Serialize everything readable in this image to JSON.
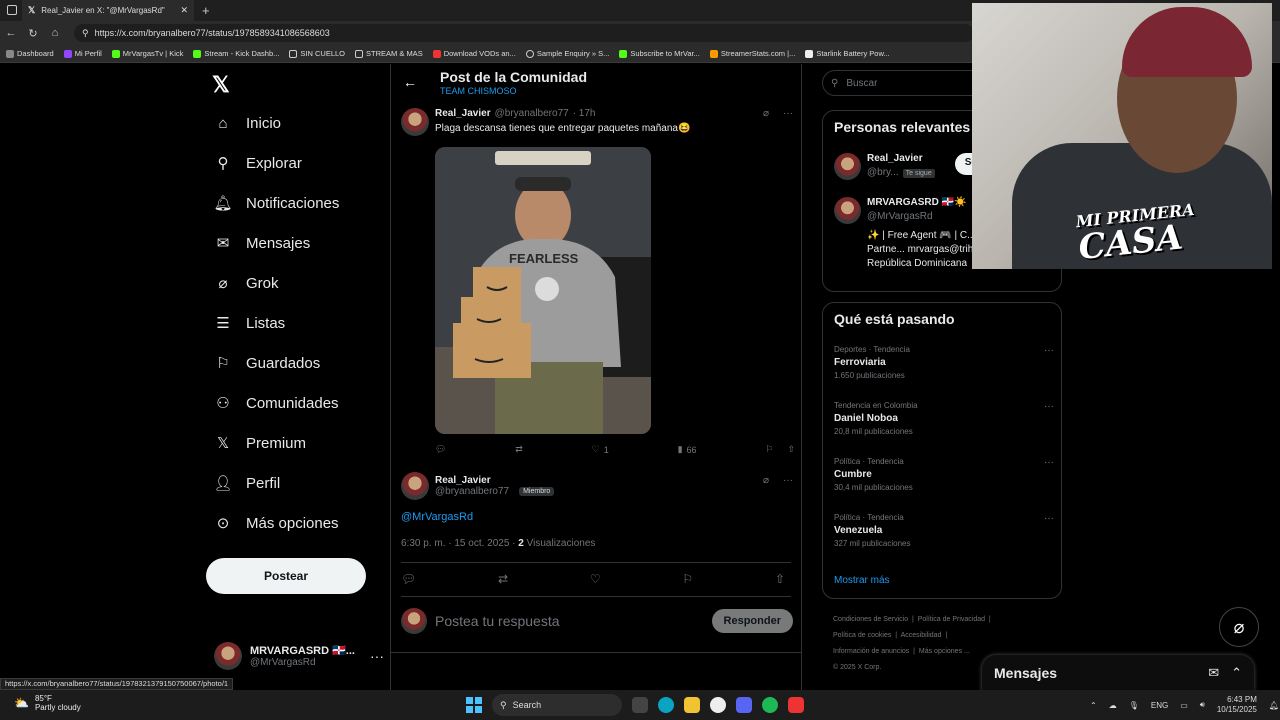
{
  "browser": {
    "tab_title": "Real_Javier en X: \"@MrVargasRd\"",
    "url": "https://x.com/bryanalbero77/status/1978589341086568603",
    "bookmarks": [
      "Dashboard",
      "Mi Perfil",
      "MrVargasTv | Kick",
      "Stream - Kick Dashb...",
      "SIN CUELLO",
      "STREAM & MAS",
      "Download VODs an...",
      "Sample Enquiry » S...",
      "Subscribe to MrVar...",
      "StreamerStats.com |...",
      "Starlink Battery Pow..."
    ],
    "status_url": "https://x.com/bryanalbero77/status/1978321379150750067/photo/1"
  },
  "nav": {
    "items": [
      "Inicio",
      "Explorar",
      "Notificaciones",
      "Mensajes",
      "Grok",
      "Listas",
      "Guardados",
      "Comunidades",
      "Premium",
      "Perfil",
      "Más opciones"
    ],
    "post_button": "Postear",
    "account_name": "MRVARGASRD 🇩🇴...",
    "account_handle": "@MrVargasRd"
  },
  "header": {
    "title": "Post de la Comunidad",
    "subtitle": "TEAM CHISMOSO"
  },
  "post": {
    "name": "Real_Javier",
    "handle": "@bryanalbero77",
    "time": "· 17h",
    "text": "Plaga descansa tienes que entregar paquetes mañana😆",
    "likes": "1",
    "views": "66",
    "image_text": "FEARLESS"
  },
  "reply": {
    "name": "Real_Javier",
    "handle": "@bryanalbero77",
    "badge": "Miembro",
    "mention": "@MrVargasRd",
    "timestamp": "6:30 p. m. · 15 oct. 2025 ·",
    "views_count": "2",
    "views_label": "Visualizaciones",
    "compose_placeholder": "Postea tu respuesta",
    "reply_button": "Responder"
  },
  "sidebar": {
    "search_placeholder": "Buscar",
    "relevant_title": "Personas relevantes",
    "person1_name": "Real_Javier",
    "person1_handle": "@bry...",
    "person1_badge": "Te sigue",
    "person1_btn": "Se",
    "person2_name": "MRVARGASRD 🇩🇴☀️",
    "person2_handle": "@MrVargasRd",
    "person2_bio": "✨ | Free Agent 🎮 | C... Contenido 💚 | Partne... mrvargas@trihaus.es 📍 | República Dominicana",
    "trending_title": "Qué está pasando",
    "trends": [
      {
        "category": "Deportes · Tendencia",
        "name": "Ferroviaria",
        "count": "1.650 publicaciones"
      },
      {
        "category": "Tendencia en Colombia",
        "name": "Daniel Noboa",
        "count": "20,8 mil publicaciones"
      },
      {
        "category": "Política · Tendencia",
        "name": "Cumbre",
        "count": "30,4 mil publicaciones"
      },
      {
        "category": "Política · Tendencia",
        "name": "Venezuela",
        "count": "327 mil publicaciones"
      }
    ],
    "show_more": "Mostrar más",
    "footer": [
      "Condiciones de Servicio",
      "Política de Privacidad",
      "Política de cookies",
      "Accesibilidad",
      "Información de anuncios",
      "Más opciones ...",
      "© 2025 X Corp."
    ]
  },
  "webcam": {
    "logo_line1": "MI PRIMERA",
    "logo_line2": "CASA"
  },
  "messages_dock": {
    "title": "Mensajes"
  },
  "taskbar": {
    "temp": "85°F",
    "weather": "Partly cloudy",
    "search": "Search",
    "lang": "ENG",
    "time": "6:43 PM",
    "date": "10/15/2025"
  },
  "colors": {
    "accent": "#1d9bf0",
    "background": "#000000",
    "border": "#2f3336"
  }
}
